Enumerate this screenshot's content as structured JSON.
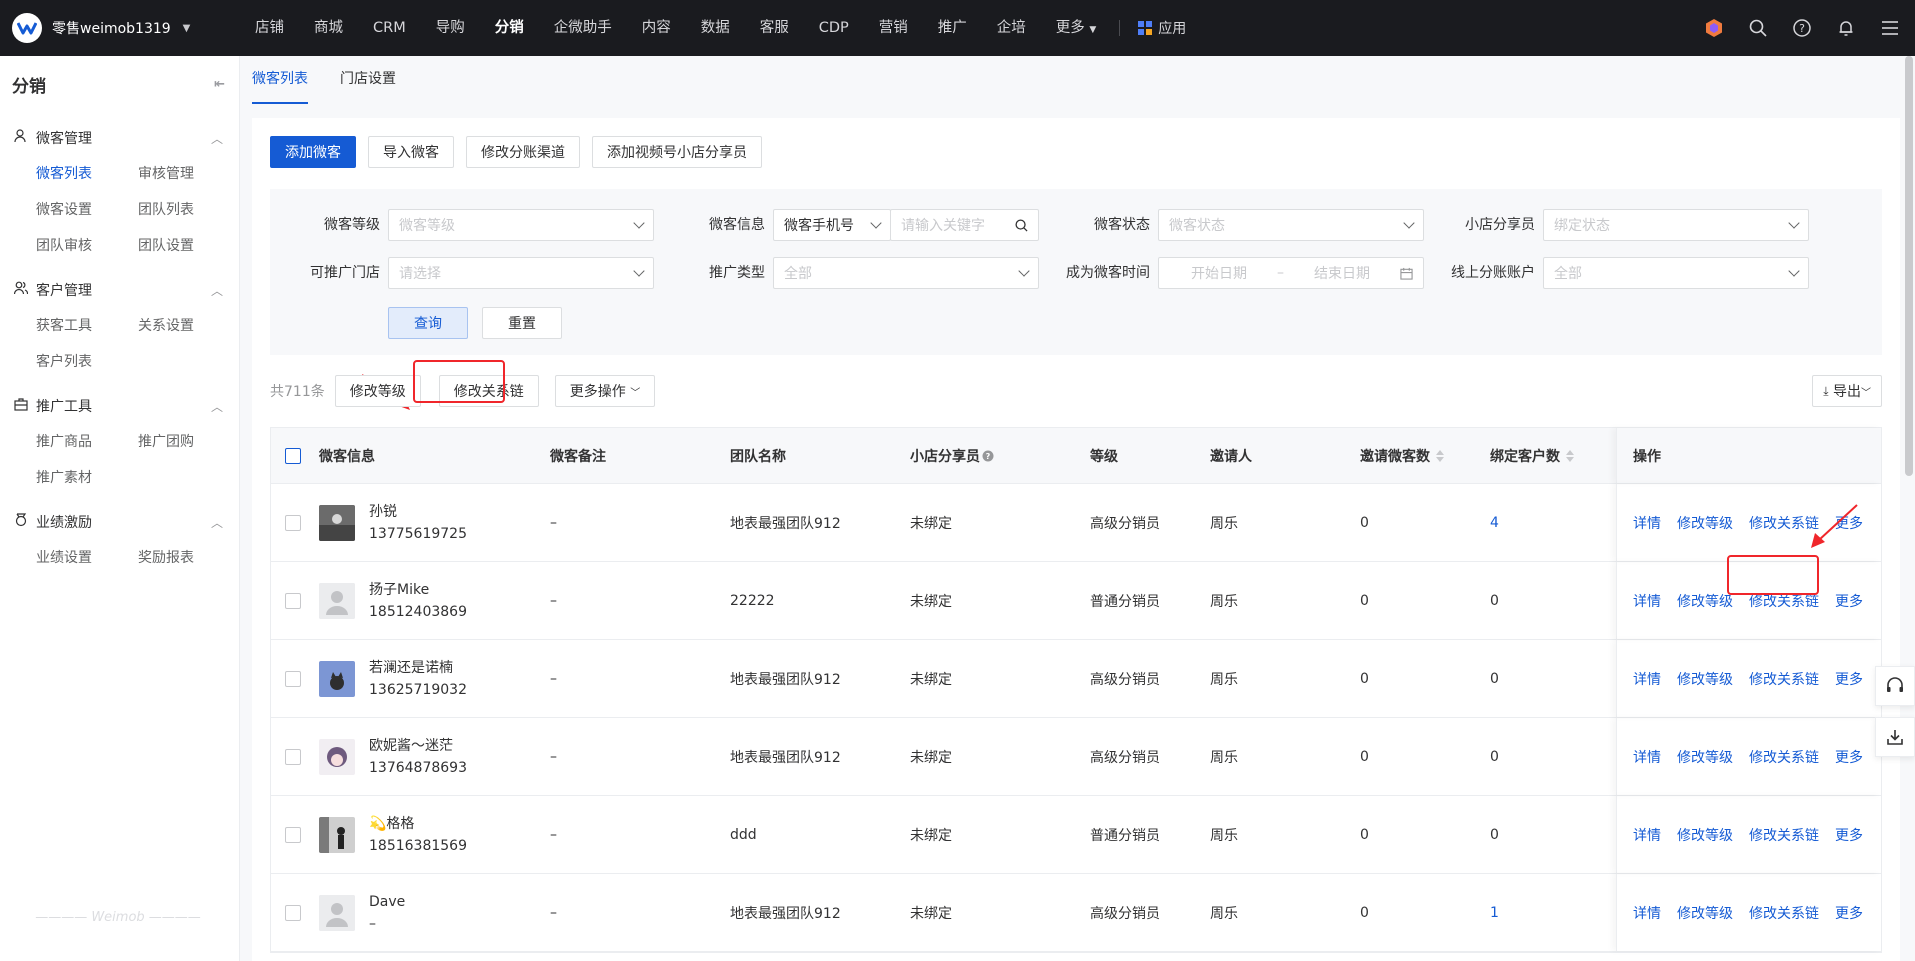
{
  "brand": {
    "name": "零售weimob1319"
  },
  "nav": {
    "items": [
      "店铺",
      "商城",
      "CRM",
      "导购",
      "分销",
      "企微助手",
      "内容",
      "数据",
      "客服",
      "CDP",
      "营销",
      "推广",
      "企培",
      "更多"
    ],
    "active": "分销",
    "apps": "应用"
  },
  "sidebar": {
    "title": "分销",
    "groups": [
      {
        "title": "微客管理",
        "items": [
          "微客列表",
          "审核管理",
          "微客设置",
          "团队列表",
          "团队审核",
          "团队设置"
        ]
      },
      {
        "title": "客户管理",
        "items": [
          "获客工具",
          "关系设置",
          "客户列表"
        ]
      },
      {
        "title": "推广工具",
        "items": [
          "推广商品",
          "推广团购",
          "推广素材"
        ]
      },
      {
        "title": "业绩激励",
        "items": [
          "业绩设置",
          "奖励报表"
        ]
      }
    ],
    "watermark": "Weimob"
  },
  "tabs": [
    "微客列表",
    "门店设置"
  ],
  "toolbar": {
    "add": "添加微客",
    "import": "导入微客",
    "channel": "修改分账渠道",
    "video": "添加视频号小店分享员"
  },
  "filters": {
    "level_label": "微客等级",
    "level_ph": "微客等级",
    "info_label": "微客信息",
    "info_type": "微客手机号",
    "info_ph": "请输入关键字",
    "status_label": "微客状态",
    "status_ph": "微客状态",
    "sharer_label": "小店分享员",
    "sharer_ph": "绑定状态",
    "store_label": "可推广门店",
    "store_ph": "请选择",
    "promo_label": "推广类型",
    "promo_ph": "全部",
    "time_label": "成为微客时间",
    "start_ph": "开始日期",
    "sep": "–",
    "end_ph": "结束日期",
    "account_label": "线上分账账户",
    "account_ph": "全部",
    "query": "查询",
    "reset": "重置"
  },
  "list": {
    "total": "共711条",
    "modify_level": "修改等级",
    "modify_chain": "修改关系链",
    "more_ops": "更多操作",
    "export": "导出"
  },
  "table": {
    "headers": [
      "微客信息",
      "微客备注",
      "团队名称",
      "小店分享员",
      "等级",
      "邀请人",
      "邀请微客数",
      "绑定客户数",
      "操作"
    ],
    "rows": [
      {
        "name": "孙锐",
        "phone": "13775619725",
        "note": "–",
        "team": "地表最强团队912",
        "sharer": "未绑定",
        "level": "高级分销员",
        "inviter": "周乐",
        "invited": "0",
        "bound": "4"
      },
      {
        "name": "扬子Mike",
        "phone": "18512403869",
        "note": "–",
        "team": "22222",
        "sharer": "未绑定",
        "level": "普通分销员",
        "inviter": "周乐",
        "invited": "0",
        "bound": "0"
      },
      {
        "name": "若澜还是诺楠",
        "phone": "13625719032",
        "note": "–",
        "team": "地表最强团队912",
        "sharer": "未绑定",
        "level": "高级分销员",
        "inviter": "周乐",
        "invited": "0",
        "bound": "0"
      },
      {
        "name": "欧妮酱～迷茫",
        "phone": "13764878693",
        "note": "–",
        "team": "地表最强团队912",
        "sharer": "未绑定",
        "level": "高级分销员",
        "inviter": "周乐",
        "invited": "0",
        "bound": "0"
      },
      {
        "name": "💫格格",
        "phone": "18516381569",
        "note": "–",
        "team": "ddd",
        "sharer": "未绑定",
        "level": "普通分销员",
        "inviter": "周乐",
        "invited": "0",
        "bound": "0"
      },
      {
        "name": "Dave",
        "phone": "–",
        "note": "–",
        "team": "地表最强团队912",
        "sharer": "未绑定",
        "level": "高级分销员",
        "inviter": "周乐",
        "invited": "0",
        "bound": "1"
      }
    ],
    "ops": [
      "详情",
      "修改等级",
      "修改关系链",
      "更多"
    ]
  },
  "colors": {
    "accent": "#155bd4",
    "highlight": "#f0262b",
    "topbar": "#1a1b1f"
  }
}
